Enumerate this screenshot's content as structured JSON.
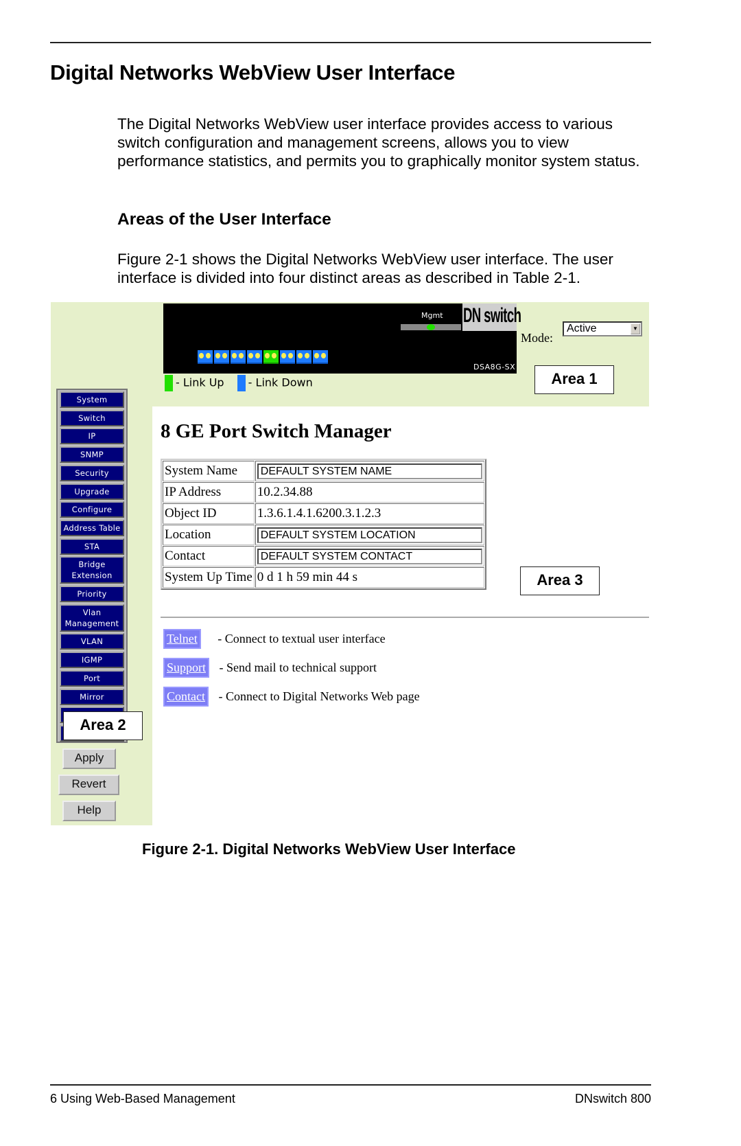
{
  "heading": "Digital Networks WebView User Interface",
  "intro": "The Digital Networks WebView user interface provides access to various switch configuration and management screens, allows you to view performance statistics, and permits you to graphically monitor system status.",
  "subheading": "Areas of the User Interface",
  "body": "Figure 2-1 shows the Digital Networks WebView user interface. The user interface is divided into four distinct areas as described in Table 2-1.",
  "figure": {
    "panel": {
      "mgmt_label": "Mgmt",
      "brand": "DN switch",
      "model": "DSA8G-SX",
      "ports": [
        {
          "port": 1,
          "status": "down"
        },
        {
          "port": 2,
          "status": "down"
        },
        {
          "port": 3,
          "status": "down"
        },
        {
          "port": 4,
          "status": "down"
        },
        {
          "port": 5,
          "status": "up"
        },
        {
          "port": 6,
          "status": "down"
        },
        {
          "port": 7,
          "status": "down"
        },
        {
          "port": 8,
          "status": "down"
        }
      ]
    },
    "mode": {
      "label": "Mode:",
      "value": "Active"
    },
    "legend": {
      "up": "- Link Up",
      "down": "- Link Down",
      "up_color": "#22e000",
      "down_color": "#1e7bff"
    },
    "areas": {
      "area1": "Area 1",
      "area2": "Area 2",
      "area3": "Area 3"
    },
    "nav": [
      "System",
      "Switch",
      "IP",
      "SNMP",
      "Security",
      "Upgrade",
      "Configure",
      "Address Table",
      "STA",
      "Bridge Extension",
      "Priority",
      "Vlan Management",
      "VLAN",
      "IGMP",
      "Port",
      "Mirror"
    ],
    "buttons": {
      "apply": "Apply",
      "revert": "Revert",
      "help": "Help"
    },
    "page_title": "8 GE Port Switch Manager",
    "info": {
      "system_name_label": "System Name",
      "system_name": "DEFAULT SYSTEM NAME",
      "ip_label": "IP Address",
      "ip": "10.2.34.88",
      "oid_label": "Object ID",
      "oid": "1.3.6.1.4.1.6200.3.1.2.3",
      "location_label": "Location",
      "location": "DEFAULT SYSTEM LOCATION",
      "contact_label": "Contact",
      "contact": "DEFAULT SYSTEM CONTACT",
      "uptime_label": "System Up Time",
      "uptime": "0 d 1 h 59 min 44 s"
    },
    "links": [
      {
        "label": "Telnet",
        "desc": "- Connect to textual user interface"
      },
      {
        "label": "Support",
        "desc": "- Send mail to technical support"
      },
      {
        "label": "Contact",
        "desc": "- Connect to Digital Networks Web page"
      }
    ]
  },
  "caption": "Figure 2-1.  Digital Networks WebView User Interface",
  "footer": {
    "left": "6  Using Web-Based Management",
    "right": "DNswitch 800"
  }
}
